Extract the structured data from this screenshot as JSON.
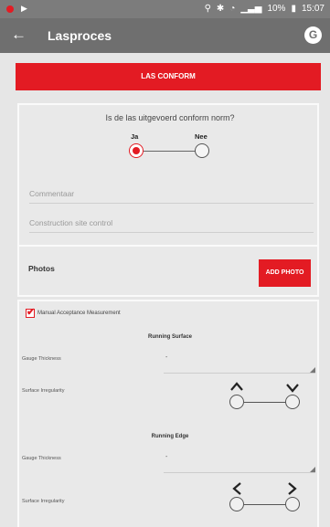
{
  "status_bar": {
    "battery_text": "10%",
    "time": "15:07"
  },
  "app_bar": {
    "back_icon": "arrow-left-icon",
    "title": "Lasproces",
    "logo_letter": "G"
  },
  "banner": {
    "label": "LAS CONFORM"
  },
  "conform": {
    "question": "Is de las uitgevoerd conform norm?",
    "options": [
      {
        "label": "Ja",
        "selected": true
      },
      {
        "label": "Nee",
        "selected": false
      }
    ],
    "comment_placeholder": "Commentaar",
    "site_control_placeholder": "Construction site control"
  },
  "photos": {
    "label": "Photos",
    "button_label": "ADD PHOTO"
  },
  "measurement": {
    "checkbox_label": "Manual Acceptance Measurement",
    "checked": true,
    "sections": [
      {
        "title": "Running Surface",
        "gauge_label": "Gauge Thickness",
        "gauge_value": "-",
        "irregularity_label": "Surface Irregularity",
        "chevron_left": "^",
        "chevron_right": "v"
      },
      {
        "title": "Running Edge",
        "gauge_label": "Gauge Thickness",
        "gauge_value": "-",
        "irregularity_label": "Surface Irregularity",
        "chevron_left": "<",
        "chevron_right": ">"
      }
    ]
  },
  "colors": {
    "accent": "#e31b23",
    "app_bar": "#6f6f6f",
    "status_bar": "#7c7c7c",
    "background": "#e6e6e6"
  }
}
